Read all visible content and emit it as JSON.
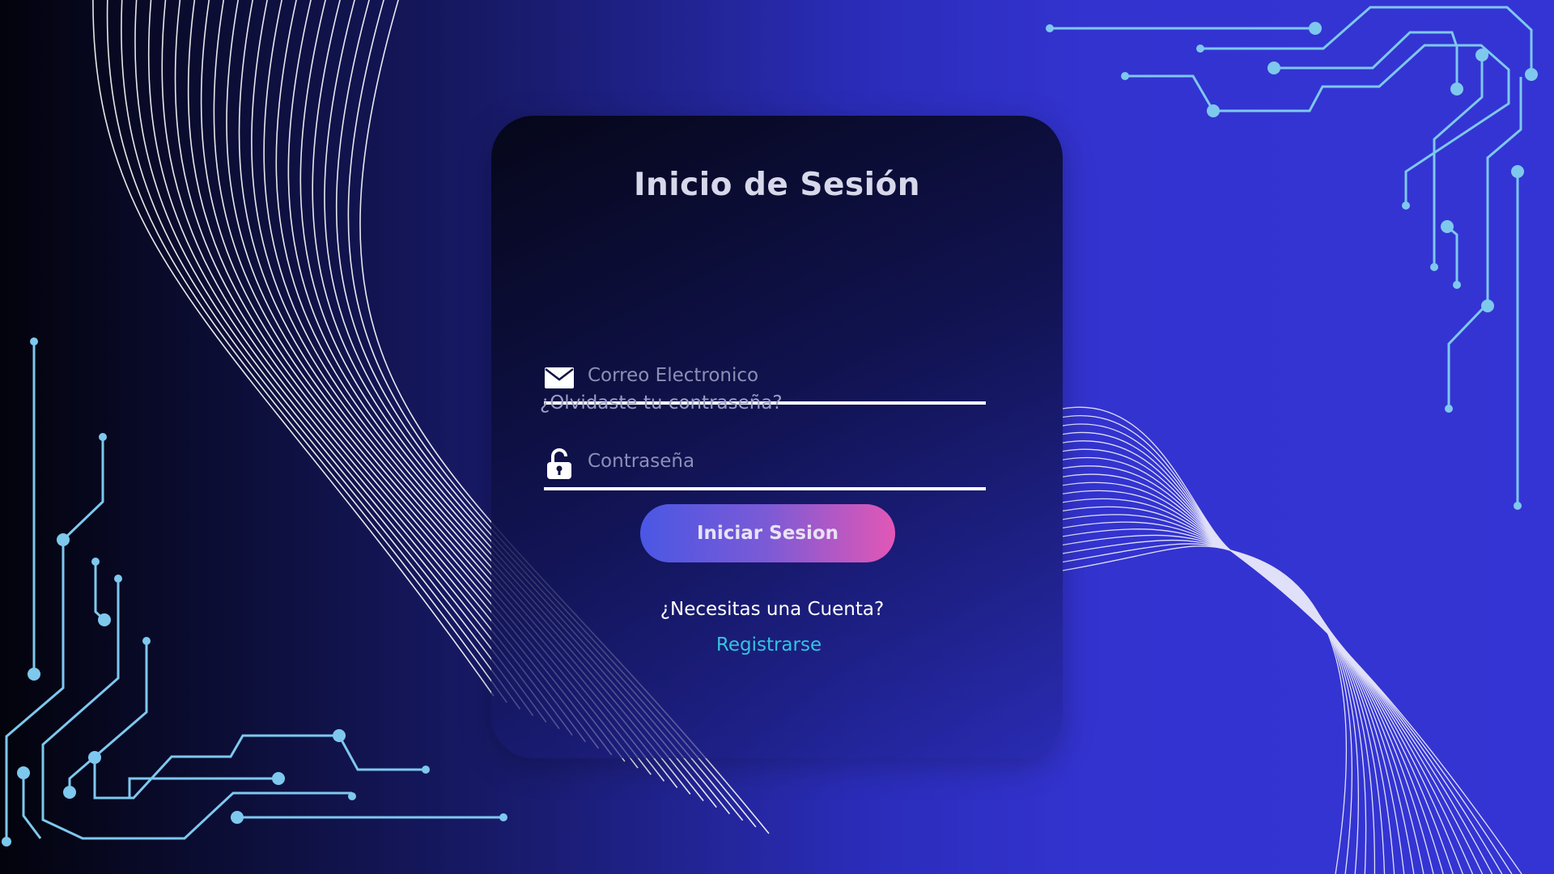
{
  "colors": {
    "circuit": "#7ec8ee",
    "wave": "#ffffff",
    "link_register": "#35c3e0",
    "button_gradient_start": "#4a57e4",
    "button_gradient_end": "#e257b5"
  },
  "login": {
    "title": "Inicio de Sesión",
    "email": {
      "icon": "envelope-icon",
      "placeholder": "Correo Electronico",
      "value": ""
    },
    "password": {
      "icon": "unlocked-padlock-icon",
      "placeholder": "Contraseña",
      "value": ""
    },
    "forgot_password": "¿Olvidaste tu contraseña?",
    "submit_label": "Iniciar Sesion",
    "need_account": "¿Necesitas una Cuenta?",
    "register_label": "Registrarse"
  }
}
